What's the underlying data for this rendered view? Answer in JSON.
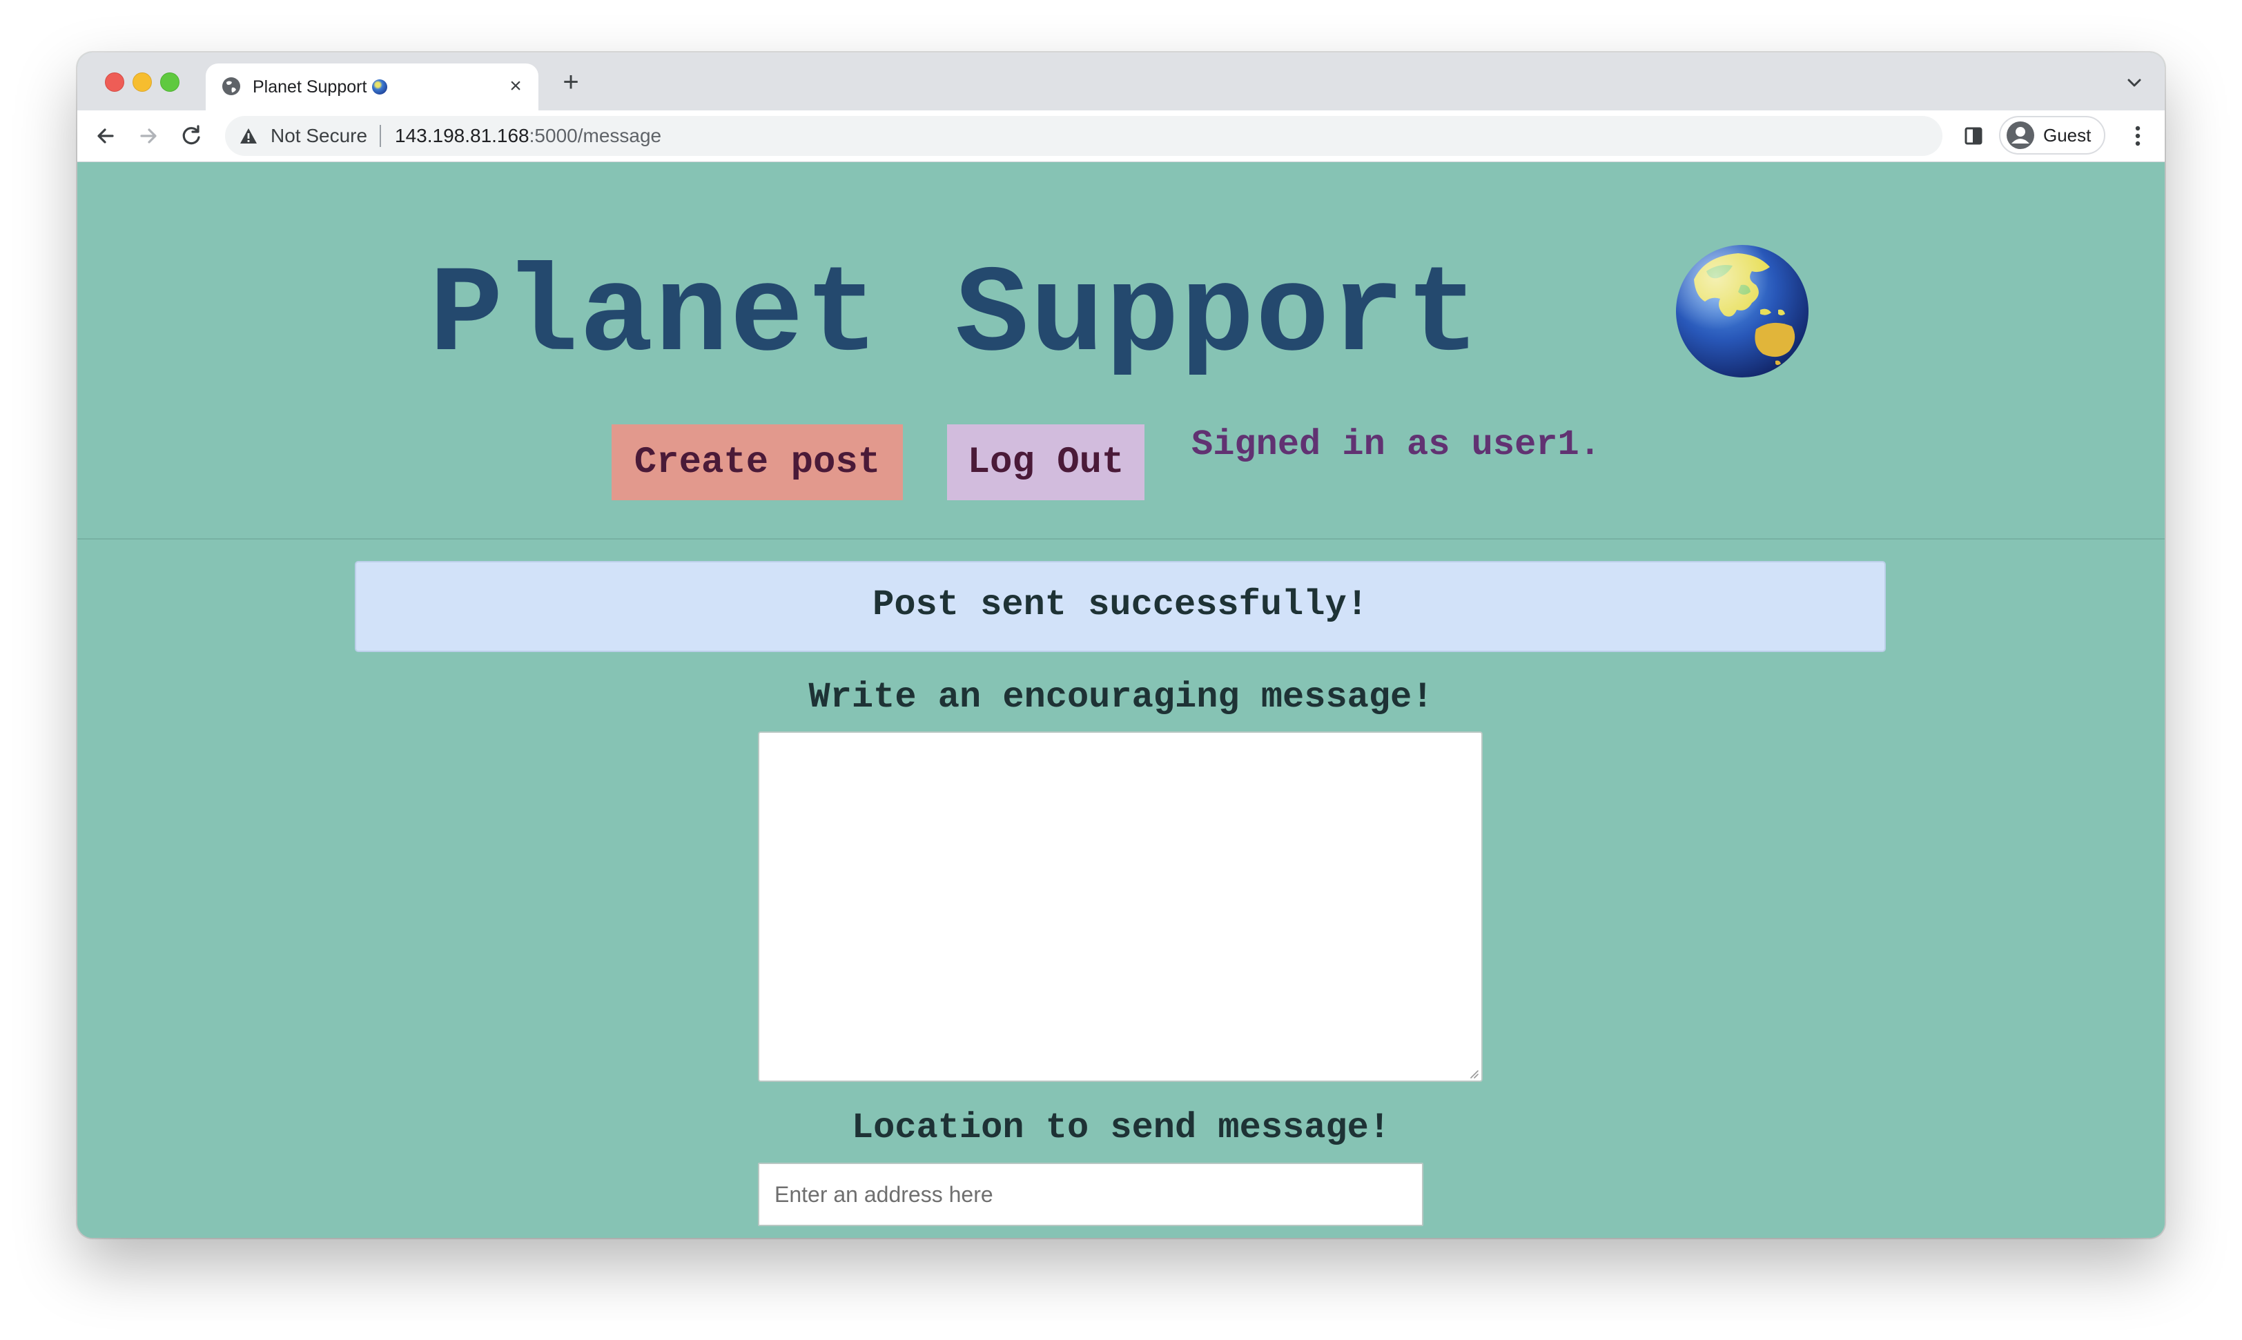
{
  "browser": {
    "tab": {
      "title": "Planet Support",
      "close_glyph": "×"
    },
    "new_tab_glyph": "+",
    "address_bar": {
      "security_label": "Not Secure",
      "url_host": "143.198.81.168",
      "url_path": ":5000/message"
    },
    "profile": {
      "name": "Guest"
    },
    "icons": {
      "favicon": "globe-icon",
      "back": "arrow-left-icon",
      "forward": "arrow-right-icon",
      "reload": "reload-icon",
      "warning": "warning-triangle-icon",
      "side_panel": "side-panel-icon",
      "avatar": "person-circle-icon",
      "menu": "three-dots-vertical-icon",
      "tab_search": "chevron-down-icon"
    }
  },
  "page": {
    "title": "Planet Support",
    "title_icon": "earth-globe-asia-australia-icon",
    "nav": {
      "create_post": "Create post",
      "log_out": "Log Out",
      "signed_in": "Signed in as user1."
    },
    "flash_message": "Post sent successfully!",
    "form": {
      "message_label": "Write an encouraging message!",
      "message_value": "",
      "location_label": "Location to send message!",
      "location_placeholder": "Enter an address here",
      "location_value": ""
    }
  },
  "colors": {
    "page_background": "#86c3b4",
    "title": "#24496e",
    "create_post_button": "#e2998d",
    "log_out_button": "#d2bcdd",
    "signed_in_text": "#613272",
    "flash_background": "#d2e2f9"
  }
}
